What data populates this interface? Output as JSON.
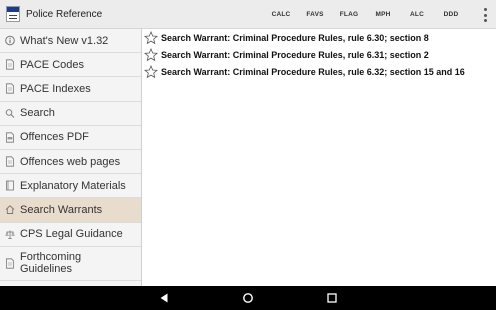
{
  "app": {
    "title": "Police Reference"
  },
  "toolbar": {
    "actions": [
      {
        "label": "CALC"
      },
      {
        "label": "FAVS"
      },
      {
        "label": "FLAG"
      },
      {
        "label": "MPH"
      },
      {
        "label": "ALC"
      },
      {
        "label": "DDD"
      }
    ]
  },
  "sidebar": {
    "items": [
      {
        "label": "What's New v1.32",
        "icon": "info-icon"
      },
      {
        "label": "PACE Codes",
        "icon": "document-icon"
      },
      {
        "label": "PACE Indexes",
        "icon": "document-icon"
      },
      {
        "label": "Search",
        "icon": "search-icon"
      },
      {
        "label": "Offences PDF",
        "icon": "pdf-icon"
      },
      {
        "label": "Offences web pages",
        "icon": "document-icon"
      },
      {
        "label": "Explanatory Materials",
        "icon": "book-icon"
      },
      {
        "label": "Search Warrants",
        "icon": "house-icon",
        "selected": true
      },
      {
        "label": "CPS Legal Guidance",
        "icon": "scales-icon"
      },
      {
        "label": "Forthcoming Guidelines",
        "icon": "document-icon"
      }
    ]
  },
  "results": [
    {
      "text": "Search Warrant: Criminal Procedure Rules, rule 6.30; section 8"
    },
    {
      "text": "Search Warrant: Criminal Procedure Rules, rule 6.31; section 2"
    },
    {
      "text": "Search Warrant: Criminal Procedure Rules, rule 6.32; section 15 and 16"
    }
  ],
  "colors": {
    "appbar": "#ececec",
    "selected_item": "#e8dccd",
    "navbar": "#000000"
  }
}
